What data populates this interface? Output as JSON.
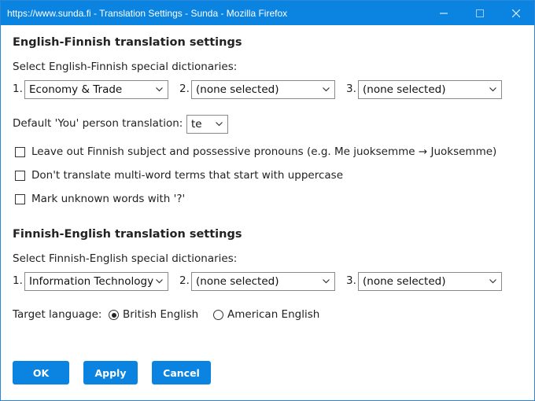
{
  "window": {
    "title": "https://www.sunda.fi - Translation Settings - Sunda - Mozilla Firefox",
    "accent": "#0a84e0"
  },
  "en_fi": {
    "heading": "English-Finnish translation settings",
    "dict_label": "Select English-Finnish special dictionaries:",
    "dicts": [
      {
        "num": "1.",
        "value": "Economy & Trade"
      },
      {
        "num": "2.",
        "value": "(none selected)"
      },
      {
        "num": "3.",
        "value": "(none selected)"
      }
    ],
    "you_label": "Default 'You' person translation:",
    "you_value": "te",
    "options": [
      {
        "label": "Leave out Finnish subject and possessive pronouns  (e.g. Me juoksemme → Juoksemme)",
        "checked": false
      },
      {
        "label": "Don't translate multi-word terms that start with uppercase",
        "checked": false
      },
      {
        "label": "Mark unknown words with '?'",
        "checked": false
      }
    ]
  },
  "fi_en": {
    "heading": "Finnish-English translation settings",
    "dict_label": "Select Finnish-English special dictionaries:",
    "dicts": [
      {
        "num": "1.",
        "value": "Information Technology"
      },
      {
        "num": "2.",
        "value": "(none selected)"
      },
      {
        "num": "3.",
        "value": "(none selected)"
      }
    ],
    "target_label": "Target language:",
    "targets": [
      {
        "label": "British English",
        "checked": true
      },
      {
        "label": "American English",
        "checked": false
      }
    ]
  },
  "buttons": {
    "ok": "OK",
    "apply": "Apply",
    "cancel": "Cancel"
  }
}
